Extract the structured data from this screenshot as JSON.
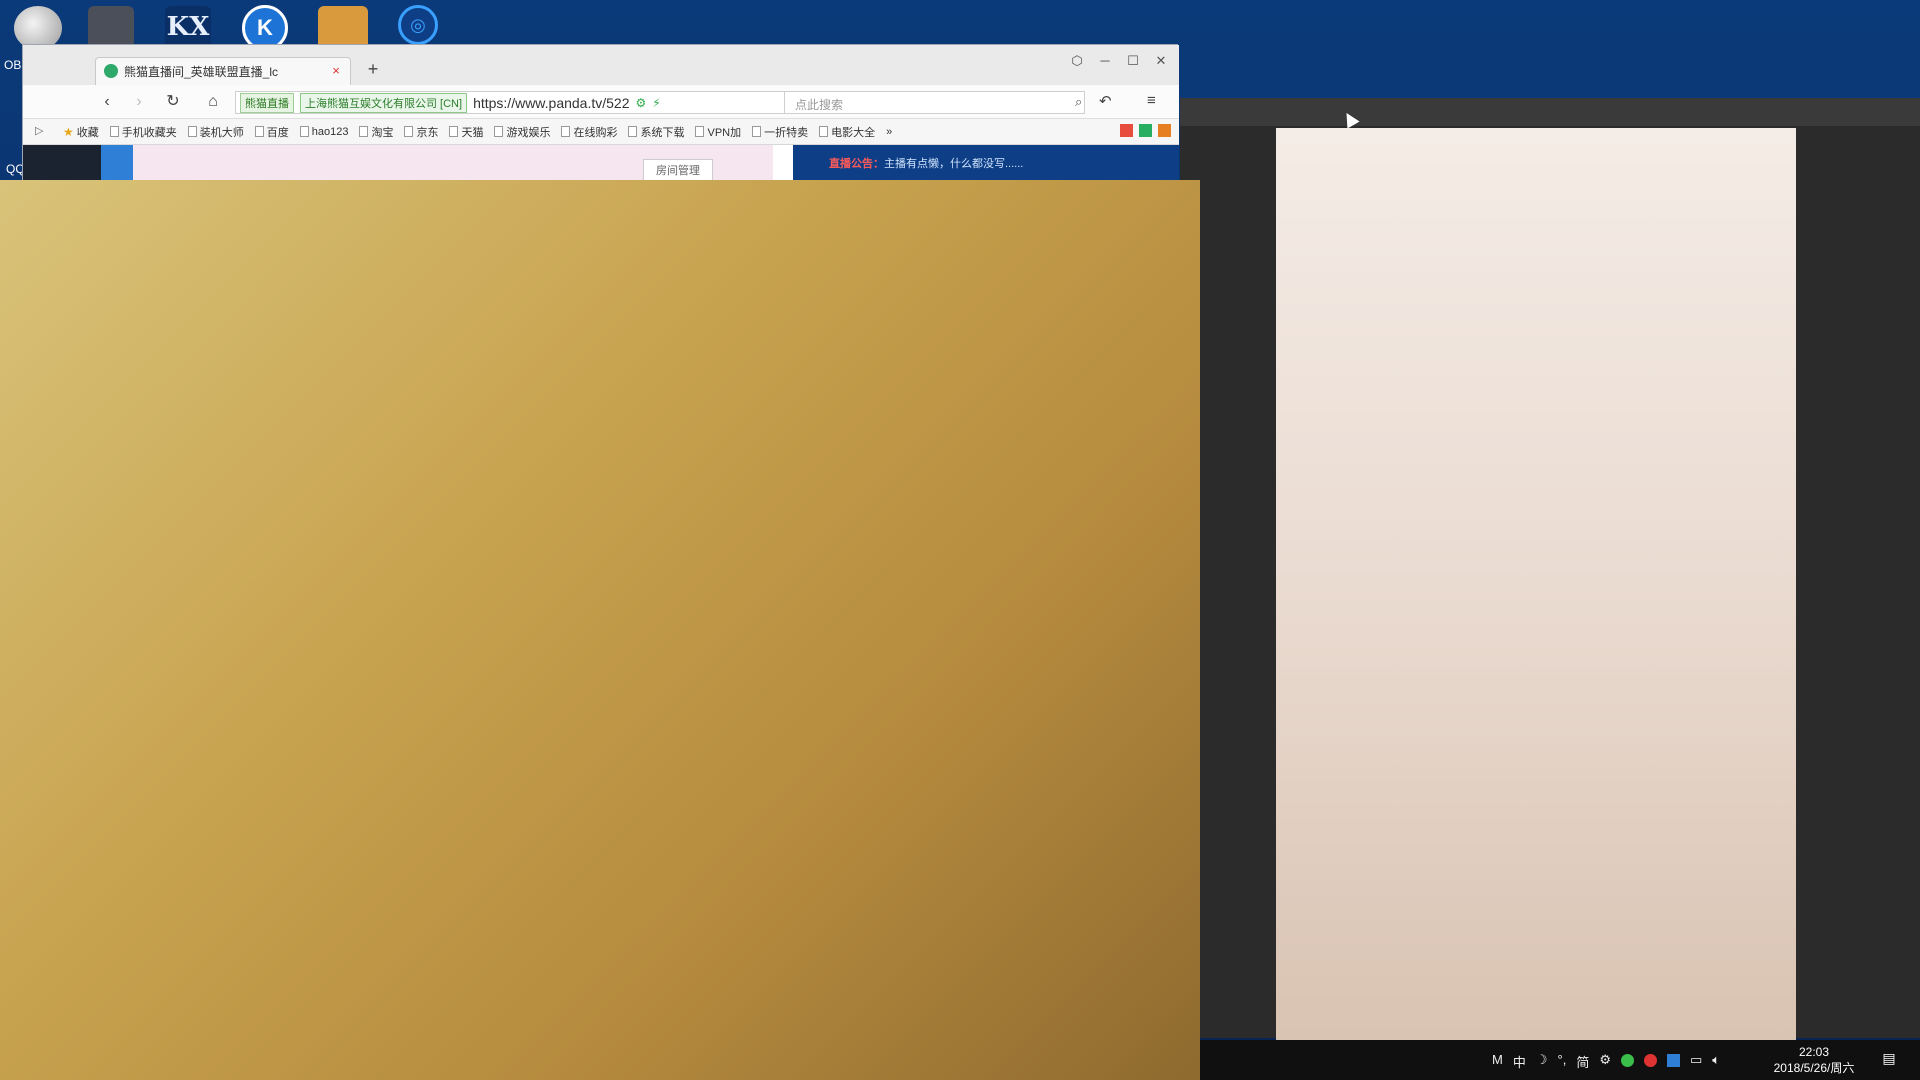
{
  "desktop": {
    "icons": [
      {
        "name": "obs-icon",
        "label": ""
      },
      {
        "name": "app-icon-2",
        "label": ""
      },
      {
        "name": "kx-icon",
        "label": "KX"
      },
      {
        "name": "kugou-icon",
        "label": "K"
      },
      {
        "name": "app-icon-5",
        "label": ""
      },
      {
        "name": "app-icon-6",
        "label": "◎"
      }
    ],
    "obs_label": "OBS",
    "qq_label": "QQ"
  },
  "browser": {
    "tab_title": "熊猫直播间_英雄联盟直播_lc",
    "tab_close": "×",
    "new_tab": "+",
    "site_badge": "熊猫直播",
    "cert_badge": "上海熊猫互娱文化有限公司 [CN]",
    "url": "https://www.panda.tv/522",
    "search_placeholder": "点此搜索",
    "bookmarks": [
      "收藏",
      "手机收藏夹",
      "装机大师",
      "百度",
      "hao123",
      "淘宝",
      "京东",
      "天猫",
      "游戏娱乐",
      "在线购彩",
      "系统下载",
      "VPN加",
      "一折特卖",
      "电影大全"
    ],
    "room_manage": "房间管理",
    "notice_label": "直播公告：",
    "notice_text": "主播有点懒，什么都没写......"
  },
  "taskbar": {
    "tray": [
      "M",
      "中",
      "☽",
      "°,",
      "简",
      "⚙"
    ],
    "time": "22:03",
    "date": "2018/5/26/周六"
  }
}
